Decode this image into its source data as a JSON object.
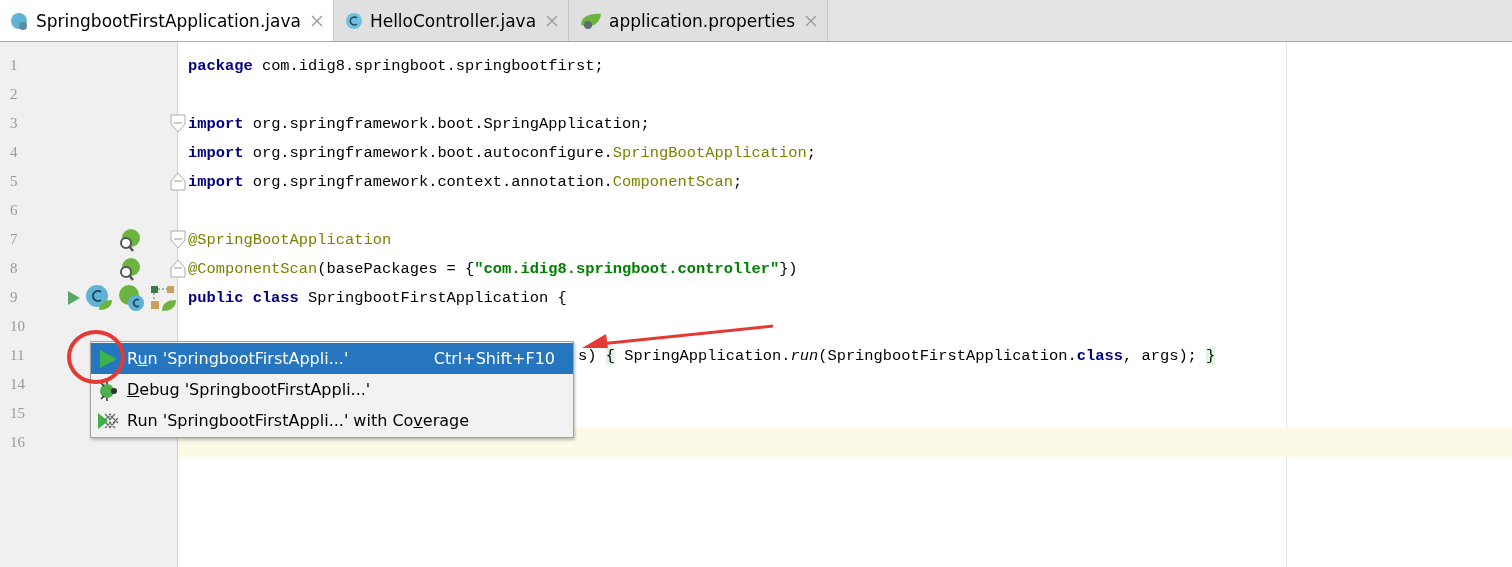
{
  "tabs": [
    {
      "label": "SpringbootFirstApplication.java",
      "kind": "spring-class",
      "selected": true
    },
    {
      "label": "HelloController.java",
      "kind": "class",
      "selected": false
    },
    {
      "label": "application.properties",
      "kind": "properties",
      "selected": false
    }
  ],
  "lines": [
    {
      "number": "1",
      "kind": "code",
      "tokens": [
        {
          "t": "package",
          "kind": "keyword"
        },
        {
          "t": " com.idig8.springboot.springbootfirst;",
          "kind": "plain"
        }
      ]
    },
    {
      "number": "2",
      "kind": "code"
    },
    {
      "number": "3",
      "kind": "fold-start",
      "tokens": [
        {
          "t": "import",
          "kind": "keyword"
        },
        {
          "t": " org.springframework.boot.SpringApplication;",
          "kind": "plain"
        }
      ]
    },
    {
      "number": "4",
      "kind": "code",
      "tokens": [
        {
          "t": "import",
          "kind": "keyword"
        },
        {
          "t": " org.springframework.boot.autoconfigure.",
          "kind": "plain"
        },
        {
          "t": "SpringBootApplication",
          "kind": "unused"
        },
        {
          "t": ";",
          "kind": "plain"
        }
      ]
    },
    {
      "number": "5",
      "kind": "fold-end",
      "tokens": [
        {
          "t": "import",
          "kind": "keyword"
        },
        {
          "t": " org.springframework.context.annotation.",
          "kind": "plain"
        },
        {
          "t": "ComponentScan",
          "kind": "unused"
        },
        {
          "t": ";",
          "kind": "plain"
        }
      ]
    },
    {
      "number": "6",
      "kind": "code"
    },
    {
      "number": "7",
      "kind": "fold-start",
      "gutter_icons": [
        {
          "kind": "bean"
        }
      ],
      "tokens": [
        {
          "t": "@SpringBootApplication",
          "kind": "annotation"
        }
      ]
    },
    {
      "number": "8",
      "kind": "fold-end",
      "gutter_icons": [
        {
          "kind": "bean"
        }
      ],
      "tokens": [
        {
          "t": "@ComponentScan",
          "kind": "annotation"
        },
        {
          "t": "(basePackages = {",
          "kind": "plain"
        },
        {
          "t": "\"com.idig8.springboot.controller\"",
          "kind": "string"
        },
        {
          "t": "})",
          "kind": "plain"
        }
      ]
    },
    {
      "number": "9",
      "kind": "code",
      "gutter_icons": [
        {
          "kind": "run"
        },
        {
          "kind": "class"
        },
        {
          "kind": "bean-class"
        },
        {
          "kind": "config"
        }
      ],
      "tokens": [
        {
          "t": "public class",
          "kind": "keyword"
        },
        {
          "t": " SpringbootFirstApplication {",
          "kind": "plain"
        }
      ]
    },
    {
      "number": "10",
      "kind": "code"
    },
    {
      "number": "11",
      "kind": "covered",
      "tokens": [
        {
          "t": "s) ",
          "kind": "plain"
        },
        {
          "t": "{",
          "kind": "brace"
        },
        {
          "t": " SpringApplication.",
          "kind": "plain"
        },
        {
          "t": "run",
          "kind": "italic"
        },
        {
          "t": "(SpringbootFirstApplication.",
          "kind": "plain"
        },
        {
          "t": "class",
          "kind": "keyword"
        },
        {
          "t": ", args); ",
          "kind": "plain"
        },
        {
          "t": "}",
          "kind": "brace"
        }
      ]
    },
    {
      "number": "14",
      "kind": "code"
    },
    {
      "number": "15",
      "kind": "code"
    },
    {
      "number": "16",
      "kind": "code",
      "current": true
    }
  ],
  "menu": [
    {
      "kind": "run",
      "label": {
        "before": "R",
        "mnemonic": "u",
        "after": "n 'SpringbootFirstAppli...'"
      },
      "shortcut": "Ctrl+Shift+F10",
      "selected": true
    },
    {
      "kind": "debug",
      "label": {
        "mnemonic": "D",
        "after": "ebug 'SpringbootFirstAppli...'"
      },
      "selected": false
    },
    {
      "kind": "coverage",
      "label": {
        "before": "Run 'SpringbootFirstAppli...' with Co",
        "mnemonic": "v",
        "after": "erage"
      },
      "selected": false
    }
  ]
}
